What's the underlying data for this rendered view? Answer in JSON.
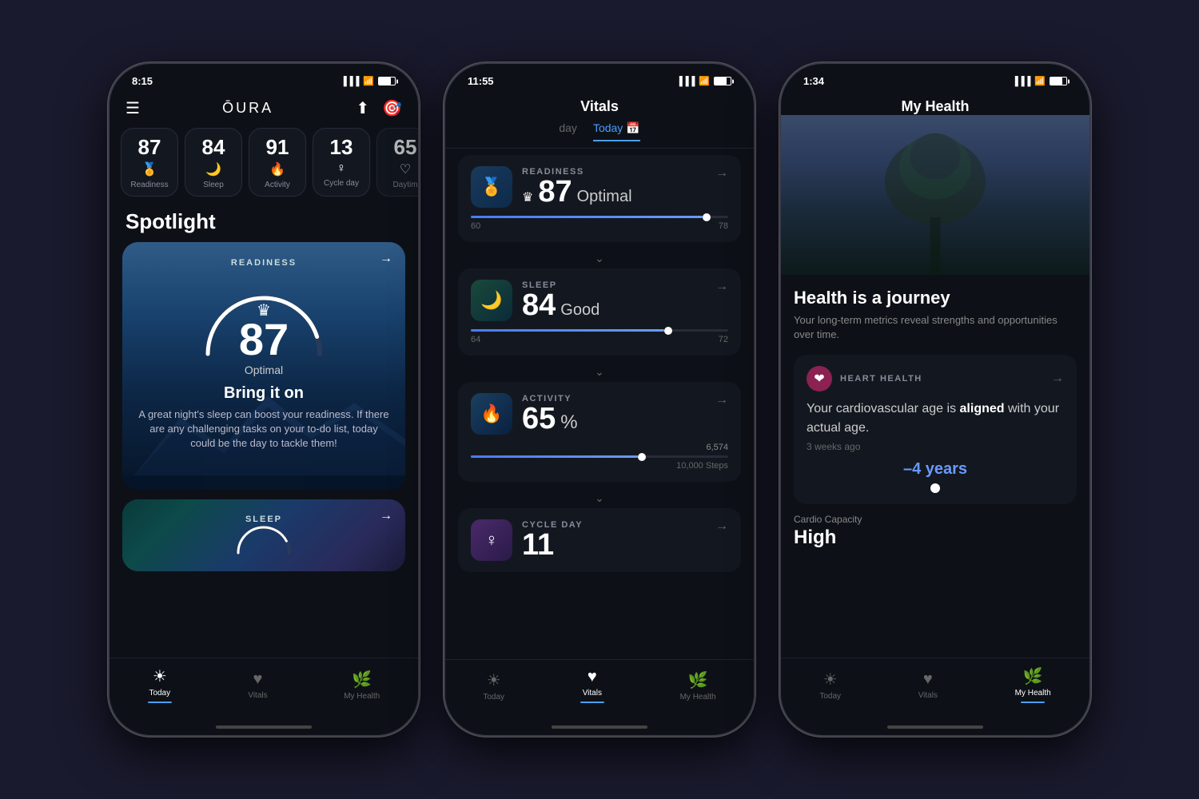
{
  "phones": [
    {
      "id": "phone1",
      "statusBar": {
        "time": "8:15",
        "signal": "▐▐▐",
        "wifi": "wifi",
        "battery": 80
      },
      "header": {
        "menu": "☰",
        "logo": "ŌURA",
        "share": "↑",
        "target": "⊙"
      },
      "scores": [
        {
          "number": "87",
          "icon": "🏅",
          "label": "Readiness"
        },
        {
          "number": "84",
          "icon": "🌙",
          "label": "Sleep"
        },
        {
          "number": "91",
          "icon": "🔥",
          "label": "Activity"
        },
        {
          "number": "13",
          "icon": "♀",
          "label": "Cycle day"
        },
        {
          "number": "65",
          "icon": "♡",
          "label": "Daytim"
        }
      ],
      "spotlight": {
        "title": "Spotlight",
        "readinessCard": {
          "type": "READINESS",
          "crown": "♛",
          "score": "87",
          "status": "Optimal",
          "headline": "Bring it on",
          "description": "A great night's sleep can boost your readiness. If there are any challenging tasks on your to-do list, today could be the day to tackle them!"
        },
        "sleepCard": {
          "type": "SLEEP"
        }
      },
      "nav": [
        {
          "icon": "☀",
          "label": "Today",
          "active": true
        },
        {
          "icon": "♥",
          "label": "Vitals",
          "active": false
        },
        {
          "icon": "🌿",
          "label": "My Health",
          "active": false
        }
      ]
    },
    {
      "id": "phone2",
      "statusBar": {
        "time": "11:55",
        "signal": "▐▐▐",
        "wifi": "wifi",
        "battery": 80
      },
      "header": {
        "title": "Vitals"
      },
      "tabs": [
        {
          "label": "day",
          "active": false
        },
        {
          "label": "Today",
          "active": true
        }
      ],
      "vitals": [
        {
          "label": "READINESS",
          "score": "87",
          "status": "Optimal",
          "crown": true,
          "iconBg": "readiness",
          "sliderFill": 90,
          "sliderThumb": 90,
          "rangeMin": "60",
          "rangeMax": "78",
          "hasChevron": true
        },
        {
          "label": "SLEEP",
          "score": "84",
          "status": "Good",
          "iconBg": "sleep",
          "sliderFill": 75,
          "sliderThumb": 75,
          "rangeMin": "64",
          "rangeMax": "72",
          "hasChevron": true
        },
        {
          "label": "ACTIVITY",
          "score": "65",
          "pct": "%",
          "iconBg": "activity",
          "sliderFill": 65,
          "sliderThumb": 65,
          "stepsCount": "6,574",
          "stepsGoal": "10,000 Steps",
          "hasChevron": true
        },
        {
          "label": "CYCLE DAY",
          "score": "11",
          "iconBg": "cycle",
          "hasChevron": false
        }
      ],
      "nav": [
        {
          "icon": "☀",
          "label": "Today",
          "active": false
        },
        {
          "icon": "♥",
          "label": "Vitals",
          "active": true
        },
        {
          "icon": "🌿",
          "label": "My Health",
          "active": false
        }
      ]
    },
    {
      "id": "phone3",
      "statusBar": {
        "time": "1:34",
        "signal": "▐▐▐",
        "wifi": "wifi",
        "battery": 80
      },
      "header": {
        "title": "My Health"
      },
      "hero": {
        "tagline": "Health is a journey",
        "subtitle": "Your long-term metrics reveal strengths and opportunities over time."
      },
      "heartHealth": {
        "label": "HEART HEALTH",
        "text1": "Your cardiovascular age is",
        "bold": "aligned",
        "text2": "with your actual age.",
        "timeAgo": "3 weeks ago",
        "years": "–4 years"
      },
      "cardioCapacity": {
        "label": "Cardio Capacity",
        "value": "High"
      },
      "nav": [
        {
          "icon": "☀",
          "label": "Today",
          "active": false
        },
        {
          "icon": "♥",
          "label": "Vitals",
          "active": false
        },
        {
          "icon": "🌿",
          "label": "My Health",
          "active": true
        }
      ]
    }
  ]
}
